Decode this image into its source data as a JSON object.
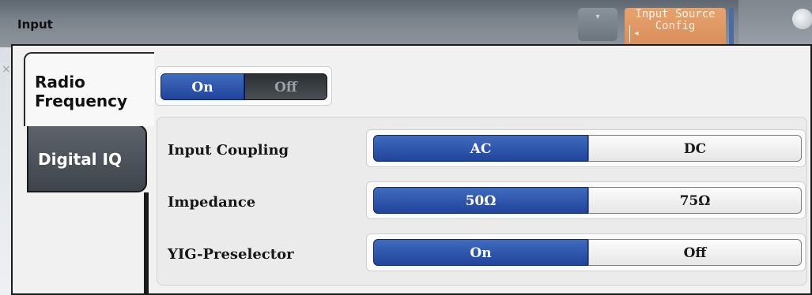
{
  "window": {
    "title": "Input"
  },
  "toolbar": {
    "dropdown_glyph": "▾",
    "softkey_label": "Input Source Config",
    "softkey_arrow_glyph": "◂"
  },
  "tabs": [
    {
      "label": "Radio Frequency",
      "selected": true
    },
    {
      "label": "Digital IQ",
      "selected": false
    }
  ],
  "state_toggle": {
    "options": [
      "On",
      "Off"
    ],
    "selected": "On"
  },
  "settings": [
    {
      "label": "Input Coupling",
      "options": [
        "AC",
        "DC"
      ],
      "selected": "AC"
    },
    {
      "label": "Impedance",
      "options": [
        "50Ω",
        "75Ω"
      ],
      "selected": "50Ω"
    },
    {
      "label": "YIG-Preselector",
      "options": [
        "On",
        "Off"
      ],
      "selected": "On"
    }
  ],
  "colors": {
    "selected_blue": "#2a4ea6",
    "softkey_orange": "#e09a63",
    "dark_tab": "#4a5058"
  },
  "icons": {
    "close": "close-icon",
    "dropdown": "chevron-down-icon",
    "softkey_arrow": "chevron-left-icon",
    "right_panel": "circle-icon"
  }
}
